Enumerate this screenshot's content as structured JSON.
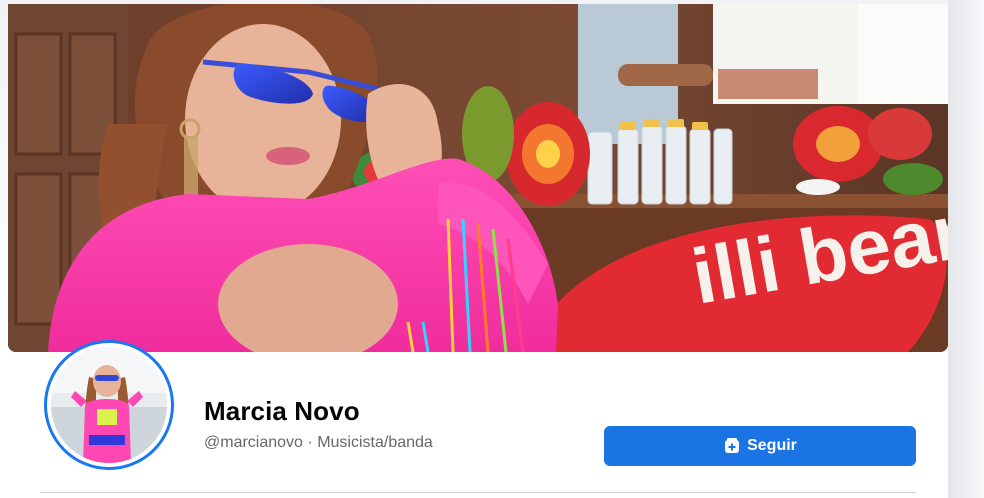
{
  "cover": {
    "sign_text": "illi beans",
    "image_alt": "cover-photo"
  },
  "profile": {
    "name": "Marcia Novo",
    "handle": "@marcianovo",
    "separator": "·",
    "category": "Musicista/banda"
  },
  "actions": {
    "follow_label": "Seguir",
    "follow_icon": "follow-page-icon"
  },
  "colors": {
    "accent": "#1b74e4",
    "avatar_ring": "#1877f2",
    "name_text": "#050505",
    "secondary_text": "#65676b",
    "divider": "#ced0d4"
  }
}
